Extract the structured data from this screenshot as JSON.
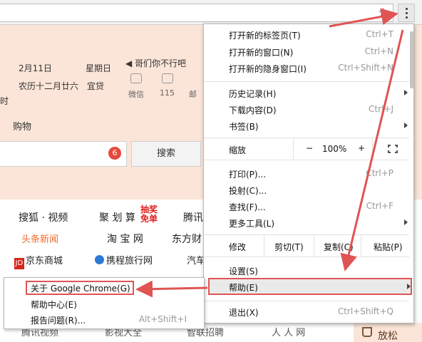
{
  "browser": {
    "star_icon": "star-icon",
    "menu_icon": "vertical-dots-icon"
  },
  "page": {
    "date": "2月11日",
    "weekday": "星期日",
    "lunar": "农历十二月廿六",
    "yi": "宜贷",
    "fragment_shi": "时",
    "music_text": "◀ 哥们你不行吧",
    "weibo_label": "微信",
    "count_label": "115",
    "mail_label": "邮",
    "shopping": "购物",
    "search_badge": "6",
    "search_button": "搜索",
    "links": {
      "sohu": "搜狐 · 视频",
      "juhuasuan": "聚 划 算",
      "promo": "抽奖免单",
      "xunlei": "腾讯",
      "toutiao": "头条新闻",
      "taobao": "淘 宝 网",
      "dongfang": "东方财",
      "jd": "京东商城",
      "jd_logo": "JD",
      "ctrip": "携程旅行网",
      "car": "汽车",
      "tencent_video": "腾讯视频",
      "film": "影视大全",
      "jobs": "智联招聘",
      "renren": "人 人 网",
      "relax": "放松"
    }
  },
  "menu": {
    "new_tab": {
      "label": "打开新的标签页(T)",
      "shortcut": "Ctrl+T"
    },
    "new_window": {
      "label": "打开新的窗口(N)",
      "shortcut": "Ctrl+N"
    },
    "incognito": {
      "label": "打开新的隐身窗口(I)",
      "shortcut": "Ctrl+Shift+N"
    },
    "history": {
      "label": "历史记录(H)"
    },
    "downloads": {
      "label": "下载内容(D)",
      "shortcut": "Ctrl+J"
    },
    "bookmarks": {
      "label": "书签(B)"
    },
    "zoom": {
      "label": "缩放",
      "minus": "−",
      "value": "100%",
      "plus": "+"
    },
    "print": {
      "label": "打印(P)...",
      "shortcut": "Ctrl+P"
    },
    "cast": {
      "label": "投射(C)..."
    },
    "find": {
      "label": "查找(F)...",
      "shortcut": "Ctrl+F"
    },
    "more_tools": {
      "label": "更多工具(L)"
    },
    "edit": {
      "label": "修改",
      "cut": "剪切(T)",
      "copy": "复制(C)",
      "paste": "粘贴(P)"
    },
    "settings": {
      "label": "设置(S)"
    },
    "help": {
      "label": "帮助(E)"
    },
    "exit": {
      "label": "退出(X)",
      "shortcut": "Ctrl+Shift+Q"
    }
  },
  "help_submenu": {
    "about": {
      "label": "关于 Google Chrome(G)"
    },
    "help_center": {
      "label": "帮助中心(E)"
    },
    "report": {
      "label": "报告问题(R)...",
      "shortcut": "Alt+Shift+I"
    }
  },
  "colors": {
    "annotation": "#e05454",
    "peach_background": "#fbe5d8",
    "link_orange": "#f06a2b"
  }
}
